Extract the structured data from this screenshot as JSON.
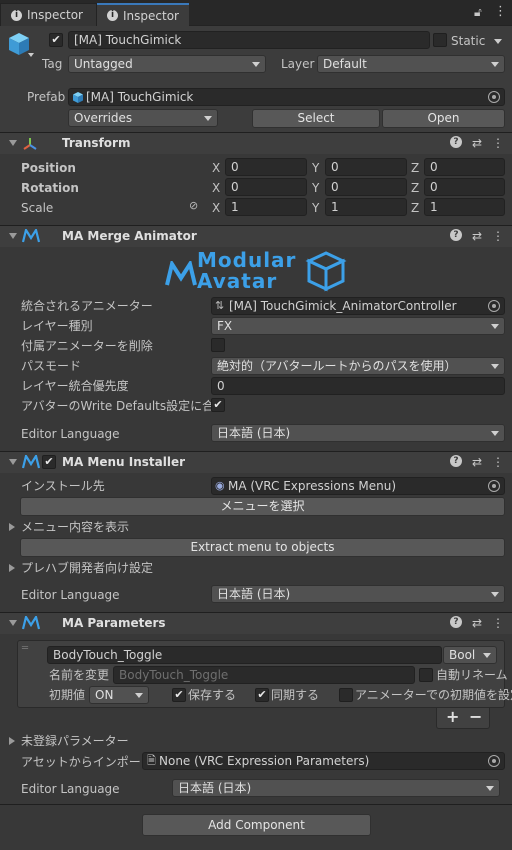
{
  "tabs": [
    {
      "label": "Inspector"
    },
    {
      "label": "Inspector"
    }
  ],
  "object": {
    "name": "[MA] TouchGimick",
    "static_label": "Static",
    "tag_label": "Tag",
    "tag_value": "Untagged",
    "layer_label": "Layer",
    "layer_value": "Default",
    "prefab_label": "Prefab",
    "prefab_value": "[MA] TouchGimick",
    "overrides": "Overrides",
    "select": "Select",
    "open": "Open"
  },
  "transform": {
    "title": "Transform",
    "position_label": "Position",
    "rotation_label": "Rotation",
    "scale_label": "Scale",
    "x": "X",
    "y": "Y",
    "z": "Z",
    "position": [
      "0",
      "0",
      "0"
    ],
    "rotation": [
      "0",
      "0",
      "0"
    ],
    "scale": [
      "1",
      "1",
      "1"
    ]
  },
  "merge": {
    "title": "MA Merge Animator",
    "logo_line1": "Modular",
    "logo_line2": "Avatar",
    "controller_label": "統合されるアニメーター",
    "controller_value": "[MA] TouchGimick_AnimatorController",
    "layer_type_label": "レイヤー種別",
    "layer_type_value": "FX",
    "delete_attached_label": "付属アニメーターを削除",
    "path_mode_label": "パスモード",
    "path_mode_value": "絶対的（アバタールートからのパスを使用）",
    "priority_label": "レイヤー統合優先度",
    "priority_value": "0",
    "write_defaults_label": "アバターのWrite Defaults設定に合わせ",
    "lang_label": "Editor Language",
    "lang_value": "日本語 (日本)"
  },
  "menu": {
    "title": "MA Menu Installer",
    "install_to_label": "インストール先",
    "install_to_value": "MA (VRC Expressions Menu)",
    "select_menu": "メニューを選択",
    "show_contents": "メニュー内容を表示",
    "extract": "Extract menu to objects",
    "prefab_dev": "プレハブ開発者向け設定",
    "lang_label": "Editor Language",
    "lang_value": "日本語 (日本)"
  },
  "params": {
    "title": "MA Parameters",
    "param_name": "BodyTouch_Toggle",
    "type": "Bool",
    "rename_label": "名前を変更",
    "rename_placeholder": "BodyTouch_Toggle",
    "auto_rename": "自動リネーム",
    "default_label": "初期値",
    "default_value": "ON",
    "saved": "保存する",
    "synced": "同期する",
    "anim_default": "アニメーターでの初期値を設定",
    "plus": "+",
    "minus": "−",
    "unregistered": "未登録パラメーター",
    "import_label": "アセットからインポートする",
    "import_value": "None (VRC Expression Parameters)",
    "lang_label": "Editor Language",
    "lang_value": "日本語 (日本)"
  },
  "add_component": "Add Component"
}
